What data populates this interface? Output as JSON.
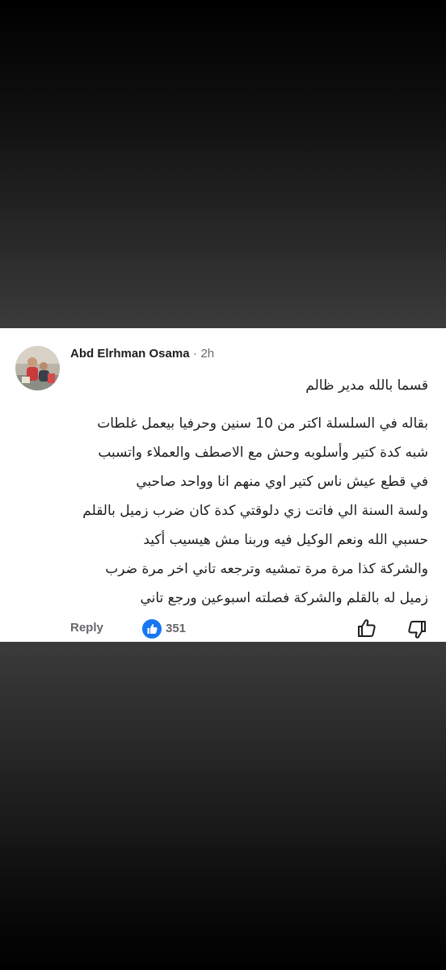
{
  "comment": {
    "author": "Abd Elrhman Osama",
    "separator": "·",
    "time": "2h",
    "lines": [
      "قسما بالله مدير ظالم",
      "بقاله في السلسلة اكتر من 10 سنين وحرفيا بيعمل غلطات",
      "شبه كدة كتير وأسلوبه وحش مع الاصطف والعملاء واتسبب",
      "في قطع عيش ناس كتير اوي منهم انا وواحد صاحبي",
      "ولسة السنة الي فاتت زي دلوقتي كدة كان ضرب زميل بالقلم",
      "حسبي الله ونعم الوكيل فيه وربنا مش هيسيب أكيد",
      "والشركة كذا مرة مرة تمشيه وترجعه تاني اخر مرة ضرب",
      "زميل له بالقلم والشركة فصلته  اسبوعين ورجع تاني"
    ]
  },
  "footer": {
    "reply_label": "Reply",
    "reaction_icon": "like-reaction-icon",
    "reaction_count": "351",
    "like_icon": "thumbs-up-outline-icon",
    "dislike_icon": "thumbs-down-outline-icon"
  },
  "colors": {
    "card_background": "#ffffff",
    "text_primary": "#1c1e21",
    "text_secondary": "#65676b",
    "reaction_blue": "#1877f2",
    "backdrop": "#3b3b3b"
  }
}
